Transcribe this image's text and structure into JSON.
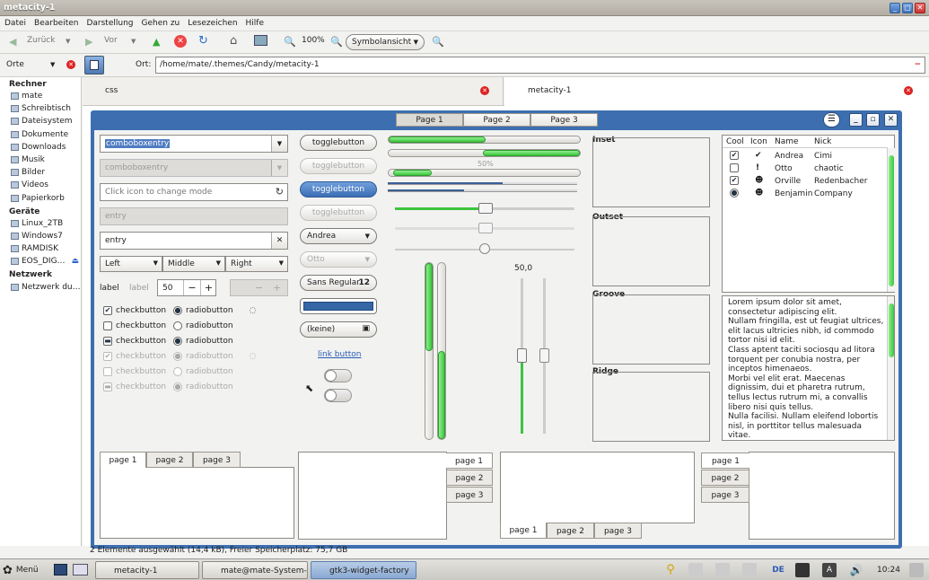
{
  "window": {
    "title": "metacity-1"
  },
  "menubar": [
    "Datei",
    "Bearbeiten",
    "Darstellung",
    "Gehen zu",
    "Lesezeichen",
    "Hilfe"
  ],
  "toolbar": {
    "back": "Zurück",
    "forward": "Vor",
    "zoom": "100%",
    "view": "Symbolansicht"
  },
  "location": {
    "places_label": "Orte",
    "path_label": "Ort:",
    "path": "/home/mate/.themes/Candy/metacity-1"
  },
  "sidebar": {
    "sections": [
      {
        "title": "Rechner",
        "items": [
          "mate",
          "Schreibtisch",
          "Dateisystem",
          "Dokumente",
          "Downloads",
          "Musik",
          "Bilder",
          "Videos",
          "Papierkorb"
        ]
      },
      {
        "title": "Geräte",
        "items": [
          "Linux_2TB",
          "Windows7",
          "RAMDISK",
          "EOS_DIG…"
        ]
      },
      {
        "title": "Netzwerk",
        "items": [
          "Netzwerk du…"
        ]
      }
    ]
  },
  "fm_tabs": [
    "css",
    "metacity-1"
  ],
  "factory": {
    "tabs": [
      "Page 1",
      "Page 2",
      "Page 3"
    ],
    "entries": {
      "combo1": "comboboxentry",
      "combo2": "comboboxentry",
      "mode_placeholder": "Click icon to change mode",
      "entry_disabled": "entry",
      "entry": "entry"
    },
    "align": [
      "Left",
      "Middle",
      "Right"
    ],
    "label1": "label",
    "label2": "label",
    "spin": "50",
    "checks": [
      "checkbutton",
      "checkbutton",
      "checkbutton",
      "checkbutton",
      "checkbutton",
      "checkbutton"
    ],
    "radios": [
      "radiobutton",
      "radiobutton",
      "radiobutton",
      "radiobutton",
      "radiobutton",
      "radiobutton"
    ],
    "toggles": [
      "togglebutton",
      "togglebutton",
      "togglebutton",
      "togglebutton"
    ],
    "combos": [
      "Andrea",
      "Otto"
    ],
    "font": {
      "name": "Sans Regular",
      "size": "12"
    },
    "file": "(keine)",
    "link": "link button",
    "progress_label": "50%",
    "scale_value": "50,0",
    "frames": [
      "Inset",
      "Outset",
      "Groove",
      "Ridge"
    ],
    "tree": {
      "headers": [
        "Cool",
        "Icon",
        "Name",
        "Nick"
      ],
      "rows": [
        {
          "name": "Andrea",
          "nick": "Cimi"
        },
        {
          "name": "Otto",
          "nick": "chaotic"
        },
        {
          "name": "Orville",
          "nick": "Redenbacher"
        },
        {
          "name": "Benjamin",
          "nick": "Company"
        }
      ]
    },
    "lorem": "Lorem ipsum dolor sit amet, consectetur adipiscing elit.\nNullam fringilla, est ut feugiat ultrices, elit lacus ultricies nibh, id commodo tortor nisi id elit.\nClass aptent taciti sociosqu ad litora torquent per conubia nostra, per inceptos himenaeos.\nMorbi vel elit erat. Maecenas dignissim, dui et pharetra rutrum, tellus lectus rutrum mi, a convallis libero nisi quis tellus.\nNulla facilisi. Nullam eleifend lobortis nisl, in porttitor tellus malesuada vitae.\nAenean lacus tellus, pellentesque quis",
    "notebook_tabs": [
      "page 1",
      "page 2",
      "page 3"
    ]
  },
  "statusbar": "2 Elemente ausgewählt (14,4 kB), Freier Speicherplatz: 75,7 GB",
  "taskbar": {
    "menu": "Menü",
    "tasks": [
      "metacity-1",
      "mate@mate-System-...",
      "gtk3-widget-factory"
    ],
    "lang": "DE",
    "clock": "10:24"
  }
}
